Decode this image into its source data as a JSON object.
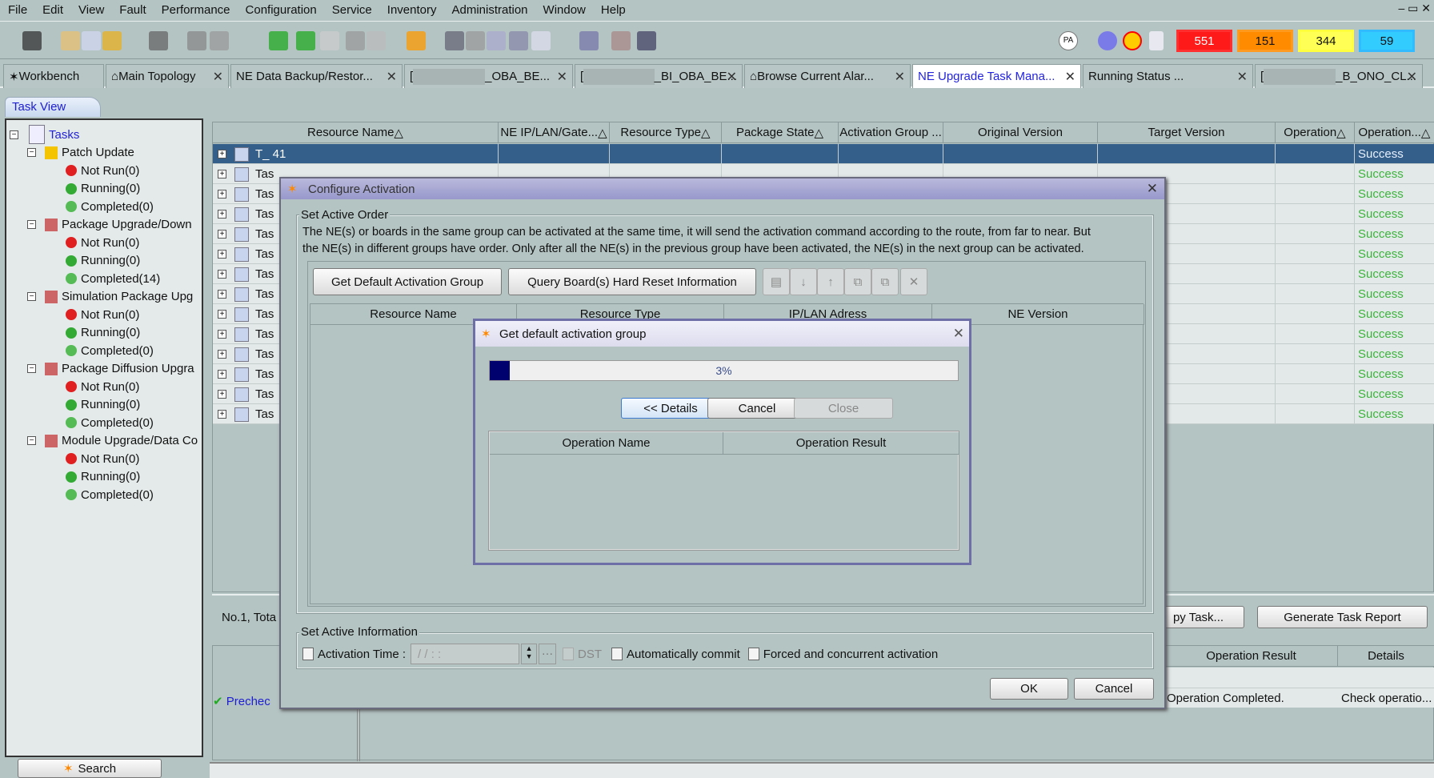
{
  "menu": [
    "File",
    "Edit",
    "View",
    "Fault",
    "Performance",
    "Configuration",
    "Service",
    "Inventory",
    "Administration",
    "Window",
    "Help"
  ],
  "alarms": [
    {
      "value": "551",
      "color": "#ff1a1a",
      "border": "#ff3030"
    },
    {
      "value": "151",
      "color": "#ff8c00",
      "border": "#ff9a20"
    },
    {
      "value": "344",
      "color": "#ffff55",
      "border": "#ffff40"
    },
    {
      "value": "59",
      "color": "#33ccff",
      "border": "#33bbff"
    }
  ],
  "tabs": [
    {
      "label": "Workbench",
      "closable": false
    },
    {
      "label": "Main Topology"
    },
    {
      "label": "NE Data Backup/Restor..."
    },
    {
      "label": "_OBA_BE..."
    },
    {
      "label": "_BI_OBA_BE..."
    },
    {
      "label": "Browse Current Alar..."
    },
    {
      "label": "NE Upgrade Task Mana...",
      "active": true
    },
    {
      "label": "Running Status ..."
    },
    {
      "label": "_B_ONO_CL..."
    }
  ],
  "left": {
    "tab": "Task View",
    "root": "Tasks",
    "groups": [
      {
        "label": "Patch Update",
        "items": [
          "Not Run(0)",
          "Running(0)",
          "Completed(0)"
        ]
      },
      {
        "label": "Package Upgrade/Down",
        "items": [
          "Not Run(0)",
          "Running(0)",
          "Completed(14)"
        ]
      },
      {
        "label": "Simulation Package Upg",
        "items": [
          "Not Run(0)",
          "Running(0)",
          "Completed(0)"
        ]
      },
      {
        "label": "Package Diffusion Upgra",
        "items": [
          "Not Run(0)",
          "Running(0)",
          "Completed(0)"
        ]
      },
      {
        "label": "Module Upgrade/Data Co",
        "items": [
          "Not Run(0)",
          "Running(0)",
          "Completed(0)"
        ]
      }
    ],
    "search": "Search"
  },
  "table": {
    "columns": [
      "Resource Name",
      "NE IP/LAN/Gate...",
      "Resource Type",
      "Package State",
      "Activation Group ...",
      "Original Version",
      "Target Version",
      "Operation",
      "Operation..."
    ],
    "rows": [
      "T_          41",
      "Tas",
      "Tas",
      "Tas",
      "Tas",
      "Tas",
      "Tas",
      "Tas",
      "Tas",
      "Tas",
      "Tas",
      "Tas",
      "Tas",
      "Tas"
    ],
    "status": "Success"
  },
  "footer": {
    "count": "No.1, Tota",
    "copy_task": "py Task...",
    "generate": "Generate Task Report"
  },
  "lower": {
    "columns": [
      "Operation Result",
      "Details"
    ],
    "precheck": "Prechec",
    "result": "Operation Completed.",
    "details": "Check operatio..."
  },
  "dialog": {
    "title": "Configure Activation",
    "order_legend": "Set Active Order",
    "desc1": "The NE(s) or boards in the same group can be activated at the same time, it will send the activation command according to the route, from far to near. But",
    "desc2": "the NE(s) in different groups have order. Only after all the NE(s) in the previous group have been activated, the NE(s) in the next group can be activated.",
    "get_default": "Get Default Activation Group",
    "query": "Query Board(s) Hard Reset Information",
    "columns": [
      "Resource Name",
      "Resource Type",
      "IP/LAN Adress",
      "NE Version"
    ],
    "info_legend": "Set Active Information",
    "activation_time": "Activation Time :",
    "time_value": "/ /     : :",
    "dst": "DST",
    "auto_commit": "Automatically commit",
    "forced": "Forced and concurrent activation",
    "ok": "OK",
    "cancel": "Cancel"
  },
  "progress": {
    "title": "Get default activation group",
    "percent": 3,
    "percent_label": "3%",
    "details": "<< Details",
    "cancel": "Cancel",
    "close": "Close",
    "columns": [
      "Operation Name",
      "Operation Result"
    ]
  }
}
